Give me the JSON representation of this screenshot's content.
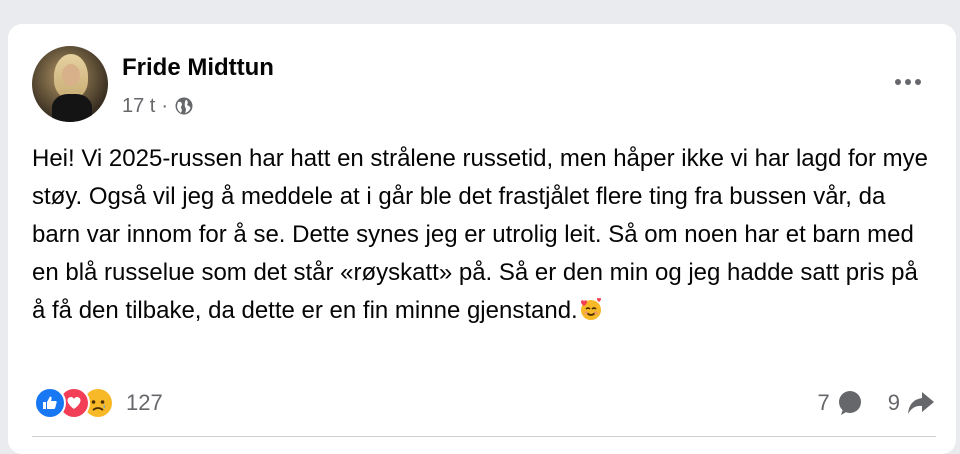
{
  "post": {
    "author": "Fride Midttun",
    "time": "17 t",
    "separator": "·",
    "privacy_icon": "globe-icon",
    "body": "Hei! Vi 2025-russen har hatt en strålene russetid, men håper ikke vi har lagd for mye støy. Også vil jeg å meddele at i går ble det frastjålet flere ting fra bussen vår, da barn var innom for å se. Dette synes jeg er utrolig leit. Så om noen har et barn med en blå russelue som det står «røyskatt» på. Så er den min og jeg hadde satt pris på å få den tilbake, da dette er en fin minne gjenstand.",
    "body_emoji": "smiling-face-with-hearts-icon"
  },
  "reactions": {
    "icons": [
      "like-icon",
      "love-icon",
      "sad-icon"
    ],
    "count": "127"
  },
  "stats": {
    "comments": "7",
    "shares": "9"
  },
  "colors": {
    "like": "#1877f2",
    "love": "#f33e58",
    "sad": "#f7b928",
    "secondary_text": "#65676b",
    "background": "#e9ebee"
  }
}
